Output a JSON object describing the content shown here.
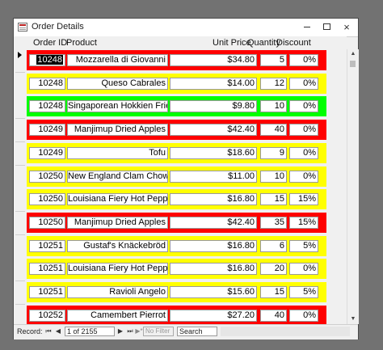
{
  "window": {
    "title": "Order Details",
    "min": "—",
    "max": "□",
    "close": "×"
  },
  "columns": {
    "order_id": "Order ID",
    "product": "Product",
    "unit_price": "Unit Price",
    "quantity": "Quantity",
    "discount": "Discount"
  },
  "colors": {
    "red": "#ff0000",
    "yellow": "#ffff00",
    "green": "#00ff00"
  },
  "rows": [
    {
      "order_id": "10248",
      "product": "Mozzarella di Giovanni",
      "unit_price": "$34.80",
      "quantity": "5",
      "discount": "0%",
      "color": "#ff0000"
    },
    {
      "order_id": "10248",
      "product": "Queso Cabrales",
      "unit_price": "$14.00",
      "quantity": "12",
      "discount": "0%",
      "color": "#ffff00"
    },
    {
      "order_id": "10248",
      "product": "Singaporean Hokkien Fried Mee",
      "unit_price": "$9.80",
      "quantity": "10",
      "discount": "0%",
      "color": "#00ff00"
    },
    {
      "order_id": "10249",
      "product": "Manjimup Dried Apples",
      "unit_price": "$42.40",
      "quantity": "40",
      "discount": "0%",
      "color": "#ff0000"
    },
    {
      "order_id": "10249",
      "product": "Tofu",
      "unit_price": "$18.60",
      "quantity": "9",
      "discount": "0%",
      "color": "#ffff00"
    },
    {
      "order_id": "10250",
      "product": "New England Clam Chowder",
      "unit_price": "$11.00",
      "quantity": "10",
      "discount": "0%",
      "color": "#ffff00"
    },
    {
      "order_id": "10250",
      "product": "Louisiana Fiery Hot Pepper Sauce",
      "unit_price": "$16.80",
      "quantity": "15",
      "discount": "15%",
      "color": "#ffff00"
    },
    {
      "order_id": "10250",
      "product": "Manjimup Dried Apples",
      "unit_price": "$42.40",
      "quantity": "35",
      "discount": "15%",
      "color": "#ff0000"
    },
    {
      "order_id": "10251",
      "product": "Gustaf's Knäckebröd",
      "unit_price": "$16.80",
      "quantity": "6",
      "discount": "5%",
      "color": "#ffff00"
    },
    {
      "order_id": "10251",
      "product": "Louisiana Fiery Hot Pepper Sauce",
      "unit_price": "$16.80",
      "quantity": "20",
      "discount": "0%",
      "color": "#ffff00"
    },
    {
      "order_id": "10251",
      "product": "Ravioli Angelo",
      "unit_price": "$15.60",
      "quantity": "15",
      "discount": "5%",
      "color": "#ffff00"
    },
    {
      "order_id": "10252",
      "product": "Camembert Pierrot",
      "unit_price": "$27.20",
      "quantity": "40",
      "discount": "0%",
      "color": "#ff0000"
    }
  ],
  "status": {
    "record_label": "Record:",
    "first": "⏮",
    "prev": "◀",
    "position": "1 of 2155",
    "next": "▶",
    "last": "⏭",
    "new": "▶*",
    "filter": "No Filter",
    "search": "Search"
  }
}
